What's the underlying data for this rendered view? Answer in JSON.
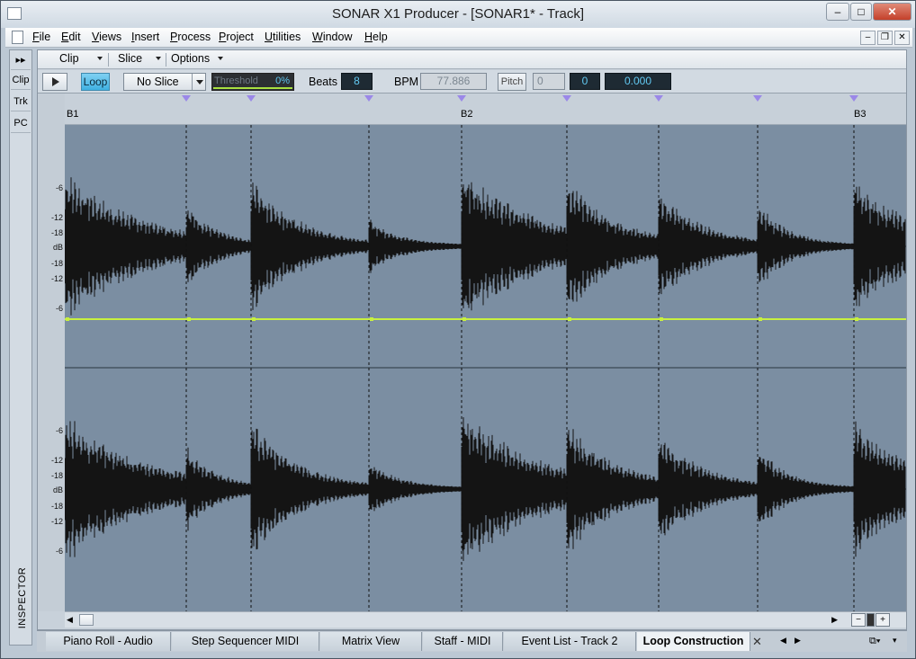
{
  "window": {
    "title": "SONAR X1 Producer - [SONAR1* - Track]",
    "minimize": "–",
    "maximize": "□",
    "close": "✕"
  },
  "menubar": {
    "items": [
      "File",
      "Edit",
      "Views",
      "Insert",
      "Process",
      "Project",
      "Utilities",
      "Window",
      "Help"
    ],
    "mdi_minimize": "–",
    "mdi_restore": "❐",
    "mdi_close": "✕"
  },
  "inspector": {
    "expand": "▸▸",
    "buttons": [
      "Clip",
      "Trk",
      "PC"
    ],
    "label": "INSPECTOR"
  },
  "view_menus": [
    "Clip",
    "Slice",
    "Options"
  ],
  "toolbar": {
    "loop_label": "Loop",
    "slice_select": "No Slice",
    "threshold_label": "Threshold",
    "threshold_value": "0%",
    "threshold_fill": 0.0,
    "beats_label": "Beats",
    "beats_value": "8",
    "bpm_label": "BPM",
    "bpm_value": "77.886",
    "pitch_button": "Pitch",
    "pitch_field": "0",
    "pitch_value": "0",
    "fine_value": "0.000"
  },
  "ruler": {
    "bars": [
      "B1",
      "B2",
      "B3"
    ]
  },
  "db_scale": {
    "labels": [
      "-6",
      "-12",
      "-18",
      "dB",
      "-18",
      "-12",
      "-6"
    ]
  },
  "colors": {
    "lane_bg": "#7b8ea2",
    "waveform": "#141414",
    "transient_marker": "#9b88e8",
    "envelope_line": "#c8f040",
    "loop_button": "#3fb1e2"
  },
  "tabs": [
    {
      "label": "Piano Roll - Audio",
      "active": false
    },
    {
      "label": "Step Sequencer MIDI",
      "active": false
    },
    {
      "label": "Matrix View",
      "active": false
    },
    {
      "label": "Staff - MIDI",
      "active": false
    },
    {
      "label": "Event List - Track 2",
      "active": false
    },
    {
      "label": "Loop Construction",
      "active": true
    }
  ],
  "tab_close": "✕",
  "tab_prev": "◀",
  "tab_next": "▶",
  "zoom": {
    "out": "−",
    "in": "+"
  }
}
